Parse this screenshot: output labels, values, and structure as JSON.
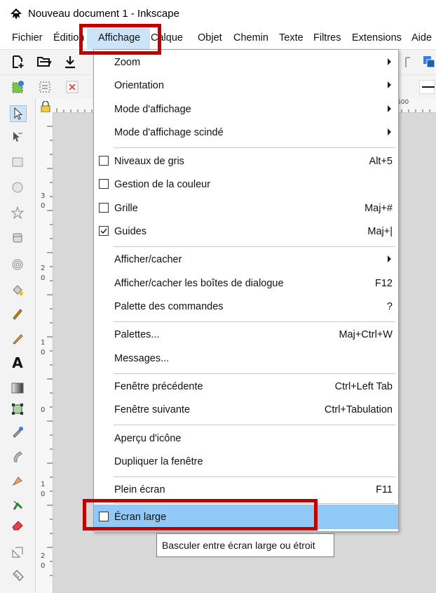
{
  "window": {
    "title": "Nouveau document 1 - Inkscape"
  },
  "menubar": {
    "items": [
      {
        "label": "Fichier"
      },
      {
        "label": "Édition"
      },
      {
        "label": "Affichage"
      },
      {
        "label": "Calque"
      },
      {
        "label": "Objet"
      },
      {
        "label": "Chemin"
      },
      {
        "label": "Texte"
      },
      {
        "label": "Filtres"
      },
      {
        "label": "Extensions"
      },
      {
        "label": "Aide"
      }
    ]
  },
  "ruler": {
    "h_label": "600",
    "v_labels": [
      "3",
      "0",
      "2",
      "0",
      "1",
      "0",
      "0",
      "1",
      "0",
      "2",
      "0"
    ]
  },
  "menu": {
    "items": [
      {
        "label": "Zoom",
        "shortcut": ""
      },
      {
        "label": "Orientation",
        "shortcut": ""
      },
      {
        "label": "Mode d'affichage",
        "shortcut": ""
      },
      {
        "label": "Mode d'affichage scindé",
        "shortcut": ""
      },
      {
        "label": "Niveaux de gris",
        "shortcut": "Alt+5"
      },
      {
        "label": "Gestion de la couleur",
        "shortcut": ""
      },
      {
        "label": "Grille",
        "shortcut": "Maj+#"
      },
      {
        "label": "Guides",
        "shortcut": "Maj+|"
      },
      {
        "label": "Afficher/cacher",
        "shortcut": ""
      },
      {
        "label": "Afficher/cacher les boîtes de dialogue",
        "shortcut": "F12"
      },
      {
        "label": "Palette des commandes",
        "shortcut": "?"
      },
      {
        "label": "Palettes...",
        "shortcut": "Maj+Ctrl+W"
      },
      {
        "label": "Messages...",
        "shortcut": ""
      },
      {
        "label": "Fenêtre précédente",
        "shortcut": "Ctrl+Left Tab"
      },
      {
        "label": "Fenêtre suivante",
        "shortcut": "Ctrl+Tabulation"
      },
      {
        "label": "Aperçu d'icône",
        "shortcut": ""
      },
      {
        "label": "Dupliquer la fenêtre",
        "shortcut": ""
      },
      {
        "label": "Plein écran",
        "shortcut": "F11"
      },
      {
        "label": "Écran large",
        "shortcut": ""
      }
    ],
    "checked": {
      "guides": true,
      "niveaux_de_gris": false,
      "gestion_couleur": false,
      "grille": false,
      "ecran_large": false
    }
  },
  "tooltip": {
    "text": "Basculer entre écran large ou étroit"
  },
  "colors": {
    "highlight_box": "#c00000",
    "hover_item": "#90c8f6",
    "menubar_active": "#cce4f7"
  }
}
